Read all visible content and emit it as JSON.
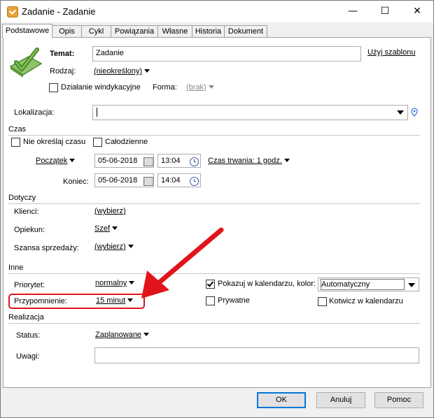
{
  "window": {
    "title": "Zadanie - Zadanie",
    "minimize": "—",
    "maximize": "☐",
    "close": "✕"
  },
  "tabs": [
    "Podstawowe",
    "Opis",
    "Cykl",
    "Powiązania",
    "Własne",
    "Historia",
    "Dokument"
  ],
  "header": {
    "temat_label": "Temat:",
    "temat_value": "Zadanie",
    "uzyj_szablonu": "Użyj szablonu",
    "rodzaj_label": "Rodzaj:",
    "rodzaj_value": "(nieokreślony)",
    "windykacyjne_label": "Działanie windykacyjne",
    "forma_label": "Forma:",
    "forma_value": "(brak)"
  },
  "lokalizacja": {
    "label": "Lokalizacja:",
    "value": ""
  },
  "czas": {
    "section": "Czas",
    "nie_okreslaj": "Nie określaj czasu",
    "calodzienne": "Całodzienne",
    "poczatek_label": "Początek",
    "poczatek_date": "05-06-2018",
    "poczatek_time": "13:04",
    "czas_trwania": "Czas trwania: 1 godz.",
    "koniec_label": "Koniec:",
    "koniec_date": "05-06-2018",
    "koniec_time": "14:04"
  },
  "dotyczy": {
    "section": "Dotyczy",
    "klienci_label": "Klienci:",
    "klienci_value": "(wybierz)",
    "opiekun_label": "Opiekun:",
    "opiekun_value": "Szef",
    "szansa_label": "Szansa sprzedaży:",
    "szansa_value": "(wybierz)"
  },
  "inne": {
    "section": "Inne",
    "priorytet_label": "Priorytet:",
    "priorytet_value": "normalny",
    "przypomnienie_label": "Przypomnienie:",
    "przypomnienie_value": "15 minut",
    "pokazuj_label": "Pokazuj w kalendarzu, kolor:",
    "kolor_value": "Automatyczny",
    "prywatne_label": "Prywatne",
    "kotwicz_label": "Kotwicz w kalendarzu"
  },
  "realizacja": {
    "section": "Realizacja",
    "status_label": "Status:",
    "status_value": "Zaplanowane",
    "uwagi_label": "Uwagi:",
    "uwagi_value": ""
  },
  "buttons": {
    "ok": "OK",
    "anuluj": "Anuluj",
    "pomoc": "Pomoc"
  },
  "colors": {
    "annotation_red": "#e2141b",
    "accent_blue": "#0078d7",
    "task_icon_green": "#6fb048"
  },
  "state": {
    "pokazuj_checked": true,
    "prywatne_checked": false,
    "kotwicz_checked": false,
    "windykacyjne_checked": false,
    "nie_okreslaj_checked": false,
    "calodzienne_checked": false
  }
}
